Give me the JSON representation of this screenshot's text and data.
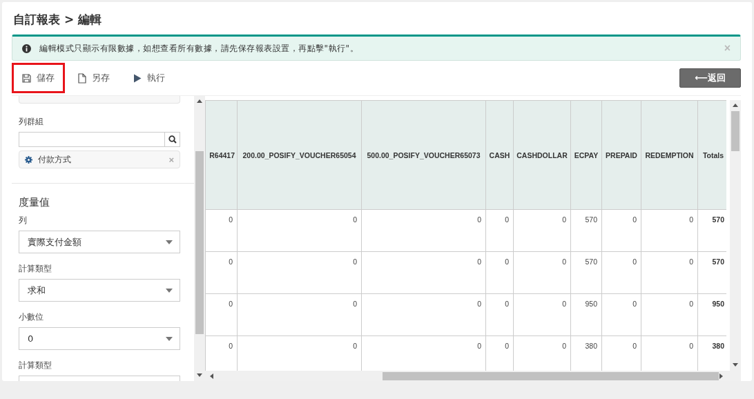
{
  "page_title": "自訂報表 > 編輯",
  "alert": {
    "message": "編輯模式只顯示有限數據，如想查看所有數據，請先保存報表設置，再點擊\"執行\"。",
    "close": "×"
  },
  "toolbar": [
    {
      "kind": "save",
      "label": "儲存",
      "highlighted": true
    },
    {
      "kind": "save_as",
      "label": "另存",
      "highlighted": false
    },
    {
      "kind": "run",
      "label": "執行",
      "highlighted": false
    }
  ],
  "back_button": "⟵返回",
  "sidebar": {
    "column_group_label": "列群組",
    "chips": [
      {
        "label": "付款方式",
        "remove": "×"
      }
    ],
    "measure_heading": "度量值",
    "fields": [
      {
        "label": "列",
        "value": "實際支付金額"
      },
      {
        "label": "計算類型",
        "value": "求和"
      },
      {
        "label": "小數位",
        "value": "0"
      },
      {
        "label": "計算類型"
      }
    ]
  },
  "table": {
    "columns": [
      "R64417",
      "200.00_POSIFY_VOUCHER65054",
      "500.00_POSIFY_VOUCHER65073",
      "CASH",
      "CASHDOLLAR",
      "ECPAY",
      "PREPAID",
      "REDEMPTION",
      "Totals"
    ],
    "rows": [
      [
        "0",
        "0",
        "0",
        "0",
        "0",
        "570",
        "0",
        "0",
        "570"
      ],
      [
        "0",
        "0",
        "0",
        "0",
        "0",
        "570",
        "0",
        "0",
        "570"
      ],
      [
        "0",
        "0",
        "0",
        "0",
        "0",
        "950",
        "0",
        "0",
        "950"
      ],
      [
        "0",
        "0",
        "0",
        "0",
        "0",
        "380",
        "0",
        "0",
        "380"
      ]
    ]
  }
}
